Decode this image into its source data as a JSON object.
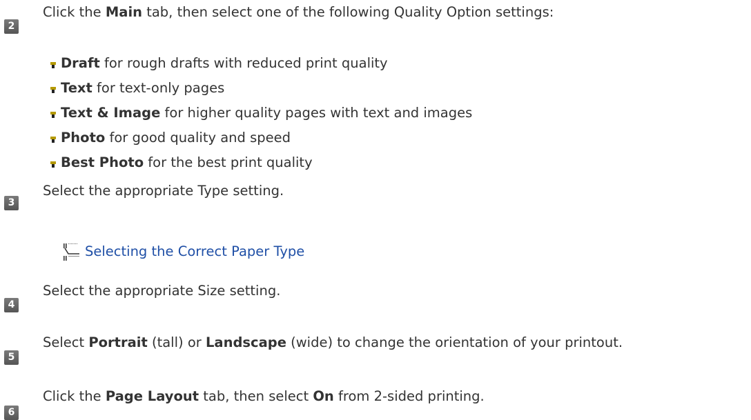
{
  "steps": [
    {
      "number": "2",
      "parts": [
        {
          "t": "Click the "
        },
        {
          "t": "Main",
          "b": true
        },
        {
          "t": " tab, then select one of the following Quality Option settings:"
        }
      ]
    },
    {
      "number": "3",
      "parts": [
        {
          "t": "Select the appropriate Type setting."
        }
      ]
    },
    {
      "number": "4",
      "parts": [
        {
          "t": "Select the appropriate Size setting."
        }
      ]
    },
    {
      "number": "5",
      "parts": [
        {
          "t": "Select "
        },
        {
          "t": "Portrait",
          "b": true
        },
        {
          "t": " (tall) or "
        },
        {
          "t": "Landscape",
          "b": true
        },
        {
          "t": " (wide) to change the orientation of your printout."
        }
      ]
    },
    {
      "number": "6",
      "parts": [
        {
          "t": "Click the "
        },
        {
          "t": "Page Layout",
          "b": true
        },
        {
          "t": " tab, then select "
        },
        {
          "t": "On",
          "b": true
        },
        {
          "t": " from 2-sided printing."
        }
      ]
    }
  ],
  "quality_options": [
    {
      "name": "Draft",
      "desc": " for rough drafts with reduced print quality"
    },
    {
      "name": "Text",
      "desc": " for text-only pages"
    },
    {
      "name": "Text & Image",
      "desc": " for higher quality pages with text and images"
    },
    {
      "name": "Photo",
      "desc": " for good quality and speed"
    },
    {
      "name": "Best Photo",
      "desc": " for the best print quality"
    }
  ],
  "link": {
    "text": "Selecting the Correct Paper Type",
    "icon": "reference-link-icon"
  },
  "colors": {
    "link": "#1f4fa6",
    "badge": "#666666",
    "text": "#333333",
    "bullet": "#a08a00"
  }
}
